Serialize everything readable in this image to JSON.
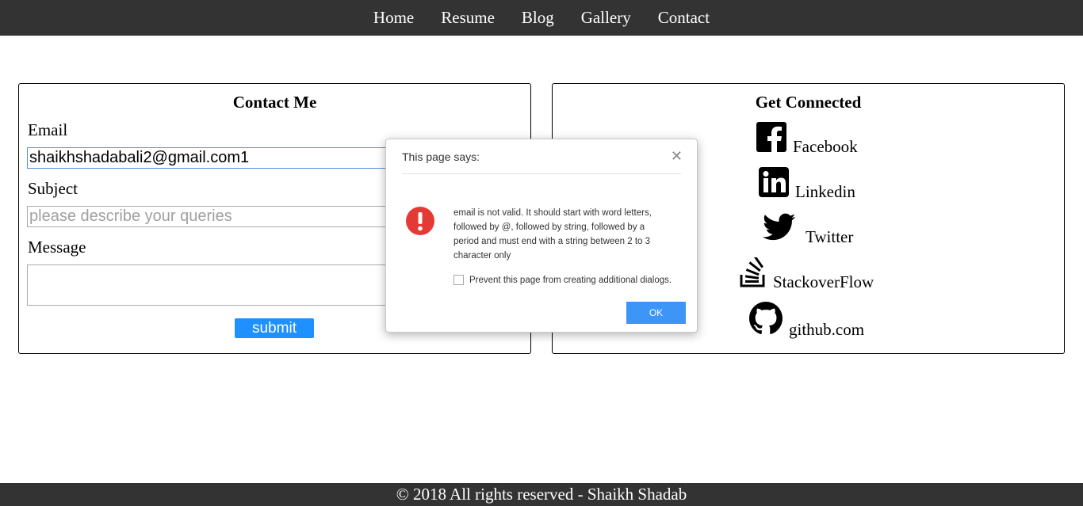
{
  "nav": {
    "items": [
      "Home",
      "Resume",
      "Blog",
      "Gallery",
      "Contact"
    ]
  },
  "contact": {
    "title": "Contact Me",
    "email_label": "Email",
    "email_value": "shaikhshadabali2@gmail.com1",
    "subject_label": "Subject",
    "subject_placeholder": "please describe your queries",
    "message_label": "Message",
    "submit_label": "submit"
  },
  "connect": {
    "title": "Get Connected",
    "links": [
      {
        "label": "Facebook",
        "icon": "facebook-icon"
      },
      {
        "label": "Linkedin",
        "icon": "linkedin-icon"
      },
      {
        "label": "Twitter",
        "icon": "twitter-icon"
      },
      {
        "label": "StackoverFlow",
        "icon": "stackoverflow-icon"
      },
      {
        "label": "github.com",
        "icon": "github-icon"
      }
    ]
  },
  "dialog": {
    "title": "This page says:",
    "message": "email is not valid. It should start with word letters, followed by @, followed by string, followed by a period and must end with a string between 2 to 3 character only",
    "checkbox_label": "Prevent this page from creating additional dialogs.",
    "ok_label": "OK",
    "icon": "error-icon",
    "icon_color": "#e53935",
    "ok_color": "#3d95f7"
  },
  "footer": {
    "text": "© 2018 All rights reserved - Shaikh Shadab"
  },
  "colors": {
    "nav_bg": "#333333",
    "submit_bg": "#1e90ff"
  }
}
